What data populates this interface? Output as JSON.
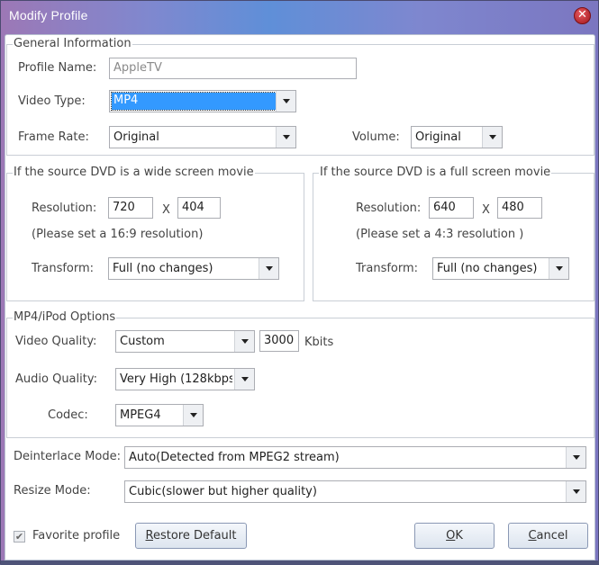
{
  "window": {
    "title": "Modify Profile",
    "close_icon": "close-circle-icon"
  },
  "general": {
    "legend": "General Information",
    "profile_name_label": "Profile Name:",
    "profile_name_value": "AppleTV",
    "video_type_label": "Video Type:",
    "video_type_value": "MP4",
    "frame_rate_label": "Frame Rate:",
    "frame_rate_value": "Original",
    "volume_label": "Volume:",
    "volume_value": "Original"
  },
  "wide": {
    "legend": "If the source DVD is a wide screen movie",
    "resolution_label": "Resolution:",
    "width": "720",
    "x_sep": "X",
    "height": "404",
    "hint": "(Please set a 16:9 resolution)",
    "transform_label": "Transform:",
    "transform_value": "Full (no changes)"
  },
  "full": {
    "legend": "If the source DVD is a full screen movie",
    "resolution_label": "Resolution:",
    "width": "640",
    "x_sep": "X",
    "height": "480",
    "hint": "(Please set a 4:3 resolution )",
    "transform_label": "Transform:",
    "transform_value": "Full (no changes)"
  },
  "mp4": {
    "legend": "MP4/iPod Options",
    "video_quality_label": "Video Quality:",
    "video_quality_value": "Custom",
    "bitrate_value": "3000",
    "bitrate_unit": "Kbits",
    "audio_quality_label": "Audio Quality:",
    "audio_quality_value": "Very High (128kbps",
    "codec_label": "Codec:",
    "codec_value": "MPEG4"
  },
  "modes": {
    "deinterlace_label": "Deinterlace Mode:",
    "deinterlace_value": "Auto(Detected from MPEG2 stream)",
    "resize_label": "Resize Mode:",
    "resize_value": "Cubic(slower but higher quality)"
  },
  "footer": {
    "favorite_label": "Favorite profile",
    "favorite_checked": true,
    "restore_first": "R",
    "restore_rest": "estore Default",
    "ok_first": "O",
    "ok_rest": "K",
    "cancel_first": "C",
    "cancel_rest": "ancel"
  }
}
